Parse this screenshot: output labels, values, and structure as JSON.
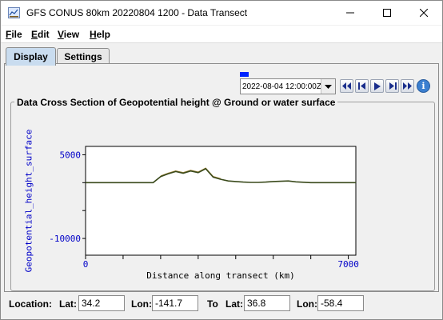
{
  "window": {
    "title": "GFS CONUS 80km 20220804 1200 - Data Transect",
    "minimize_icon": "minimize-icon",
    "maximize_icon": "maximize-icon",
    "close_icon": "close-icon"
  },
  "menu": {
    "items": [
      {
        "label": "File",
        "mnemonic": "F",
        "rest": "ile"
      },
      {
        "label": "Edit",
        "mnemonic": "E",
        "rest": "dit"
      },
      {
        "label": "View",
        "mnemonic": "V",
        "rest": "iew"
      },
      {
        "label": "Help",
        "mnemonic": "H",
        "rest": "elp"
      }
    ]
  },
  "tabs": [
    {
      "label": "Display",
      "active": true
    },
    {
      "label": "Settings",
      "active": false
    }
  ],
  "animation": {
    "time_value": "2022-08-04 12:00:00Z",
    "buttons": [
      "first-frame-icon",
      "step-back-icon",
      "play-icon",
      "step-forward-icon",
      "last-frame-icon"
    ],
    "info_label": "i"
  },
  "plot": {
    "title": "Data Cross Section  of Geopotential height @ Ground or water surface",
    "ylabel": "Geopotential_height_surface",
    "xlabel": "Distance along transect (km)",
    "colors": {
      "axis_text": "#0000c8",
      "line": "#3a4a1c",
      "terrain": "#a88a3c"
    }
  },
  "chart_data": {
    "type": "line",
    "title": "Data Cross Section  of Geopotential height @ Ground or water surface",
    "xlabel": "Distance along transect (km)",
    "ylabel": "Geopotential_height_surface",
    "xlim": [
      0,
      7200
    ],
    "ylim": [
      -13000,
      6500
    ],
    "x_ticks": [
      0,
      7000
    ],
    "y_ticks": [
      5000,
      -10000
    ],
    "x_minor_ticks": [
      1000,
      2000,
      3000,
      4000,
      5000,
      6000
    ],
    "y_minor_ticks": [
      0,
      -5000
    ],
    "grid": false,
    "series": [
      {
        "x": [
          0,
          500,
          1000,
          1500,
          1800,
          2000,
          2200,
          2400,
          2600,
          2800,
          3000,
          3200,
          3400,
          3600,
          3800,
          4000,
          4200,
          4400,
          4600,
          4800,
          5000,
          5200,
          5400,
          5600,
          5800,
          6000,
          6200,
          6500,
          7000,
          7200
        ],
        "y": [
          0,
          0,
          0,
          0,
          0,
          1100,
          1600,
          2000,
          1700,
          2100,
          1800,
          2500,
          1000,
          600,
          300,
          200,
          100,
          50,
          50,
          100,
          200,
          250,
          300,
          150,
          80,
          0,
          0,
          0,
          0,
          0
        ]
      }
    ]
  },
  "location": {
    "location_label": "Location:",
    "lat_label": "Lat:",
    "lat_value": "34.2",
    "lon_label": "Lon:",
    "lon_value": "-141.7",
    "to_label": "To",
    "to_lat_label": "Lat:",
    "to_lat_value": "36.8",
    "to_lon_label": "Lon:",
    "to_lon_value": "-58.4"
  }
}
